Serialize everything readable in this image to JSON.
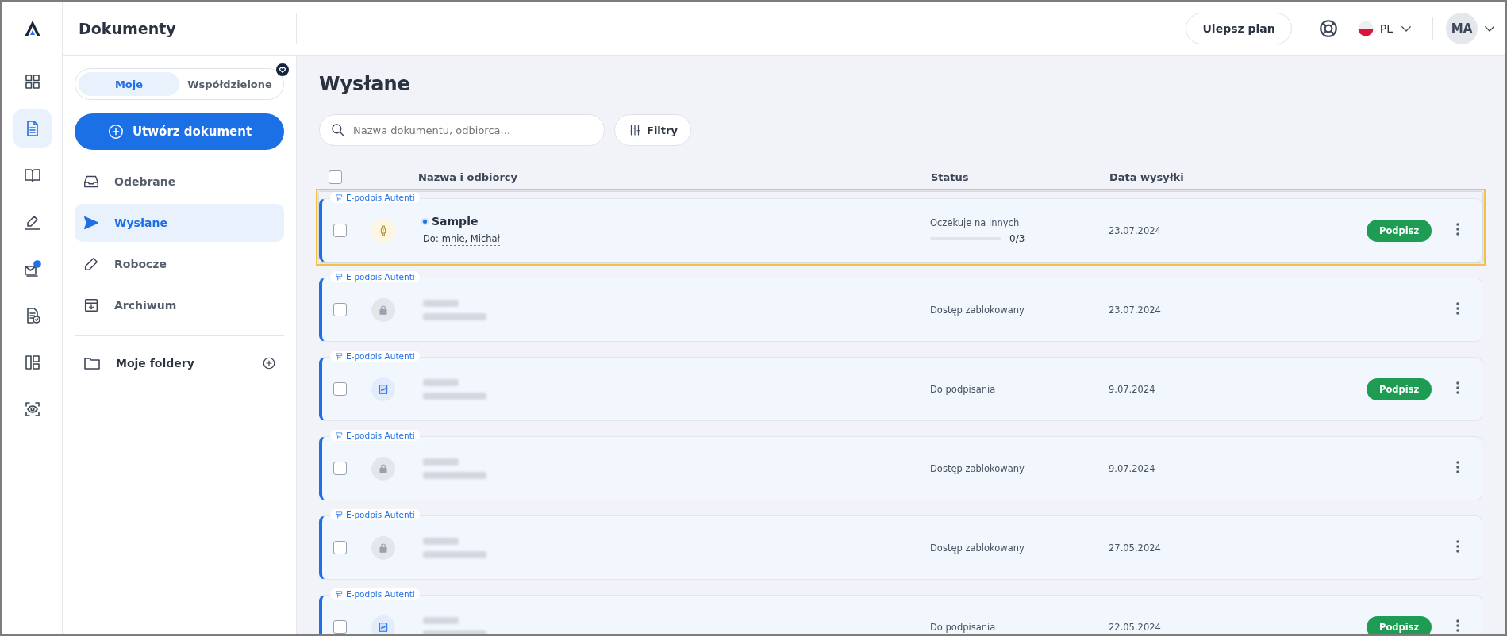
{
  "header": {
    "title": "Dokumenty",
    "upgrade_button": "Ulepsz plan",
    "language": "PL",
    "avatar": "MA"
  },
  "rail_items": [
    {
      "selected": false
    },
    {
      "selected": true
    },
    {
      "selected": false
    },
    {
      "selected": false
    },
    {
      "selected": false
    },
    {
      "selected": false
    },
    {
      "selected": false
    },
    {
      "selected": false
    }
  ],
  "sidebar": {
    "tabs": [
      {
        "label": "Moje",
        "selected": true
      },
      {
        "label": "Współdzielone",
        "selected": false
      }
    ],
    "create_button": "Utwórz dokument",
    "items": [
      {
        "label": "Odebrane",
        "selected": false
      },
      {
        "label": "Wysłane",
        "selected": true
      },
      {
        "label": "Robocze",
        "selected": false
      },
      {
        "label": "Archiwum",
        "selected": false
      }
    ],
    "folders_label": "Moje foldery"
  },
  "main": {
    "title": "Wysłane",
    "search": {
      "placeholder": "Nazwa dokumentu, odbiorca..."
    },
    "filter_button": "Filtry",
    "select_all_checked": false,
    "columns": [
      "Nazwa i odbiorcy",
      "Status",
      "Data wysyłki"
    ],
    "rows": [
      {
        "tag": "E-podpis Autenti",
        "kind": "watch",
        "redacted": false,
        "highlighted": true,
        "checked": false,
        "title": "Sample",
        "recipients_label": "Do:",
        "recipients": "mnie, Michał",
        "status": "Oczekuje na innych",
        "level": 0,
        "progress_text": "0/3",
        "date": "23.07.2024",
        "action": "Podpisz"
      },
      {
        "tag": "E-podpis Autenti",
        "kind": "lock",
        "redacted": true,
        "highlighted": false,
        "checked": false,
        "status": "Dostęp zablokowany",
        "date": "23.07.2024"
      },
      {
        "tag": "E-podpis Autenti",
        "kind": "doc",
        "redacted": true,
        "highlighted": false,
        "checked": false,
        "status": "Do podpisania",
        "date": "9.07.2024",
        "action": "Podpisz"
      },
      {
        "tag": "E-podpis Autenti",
        "kind": "lock",
        "redacted": true,
        "highlighted": false,
        "checked": false,
        "status": "Dostęp zablokowany",
        "date": "9.07.2024"
      },
      {
        "tag": "E-podpis Autenti",
        "kind": "lock",
        "redacted": true,
        "highlighted": false,
        "checked": false,
        "status": "Dostęp zablokowany",
        "date": "27.05.2024"
      },
      {
        "tag": "E-podpis Autenti",
        "kind": "doc",
        "redacted": true,
        "highlighted": false,
        "checked": false,
        "status": "Do podpisania",
        "date": "22.05.2024",
        "action": "Podpisz"
      }
    ]
  }
}
